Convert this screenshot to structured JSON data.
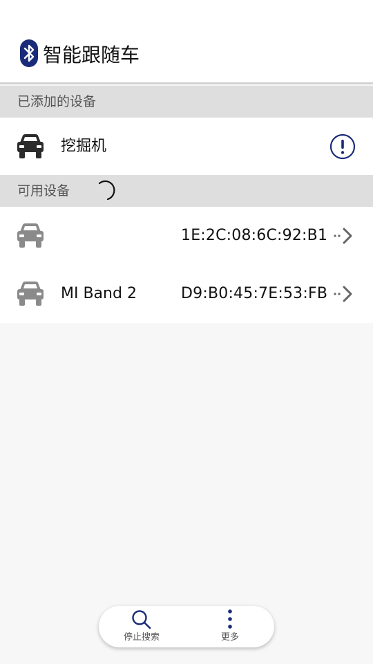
{
  "app": {
    "title": "智能跟随车",
    "accent_color": "#1a2b7a"
  },
  "added_section": {
    "label": "已添加的设备",
    "devices": [
      {
        "name": "挖掘机",
        "icon": "car-icon",
        "status_icon": "exclamation-circle-icon"
      }
    ]
  },
  "available_section": {
    "label": "可用设备",
    "scanning": true,
    "devices": [
      {
        "name": "",
        "mac": "1E:2C:08:6C:92:B1",
        "icon": "car-icon",
        "action_icon": "arrow-right-icon"
      },
      {
        "name": "MI Band 2",
        "mac": "D9:B0:45:7E:53:FB",
        "icon": "car-icon",
        "action_icon": "arrow-right-icon"
      }
    ]
  },
  "bottom_bar": {
    "stop_search_label": "停止搜索",
    "more_label": "更多"
  }
}
